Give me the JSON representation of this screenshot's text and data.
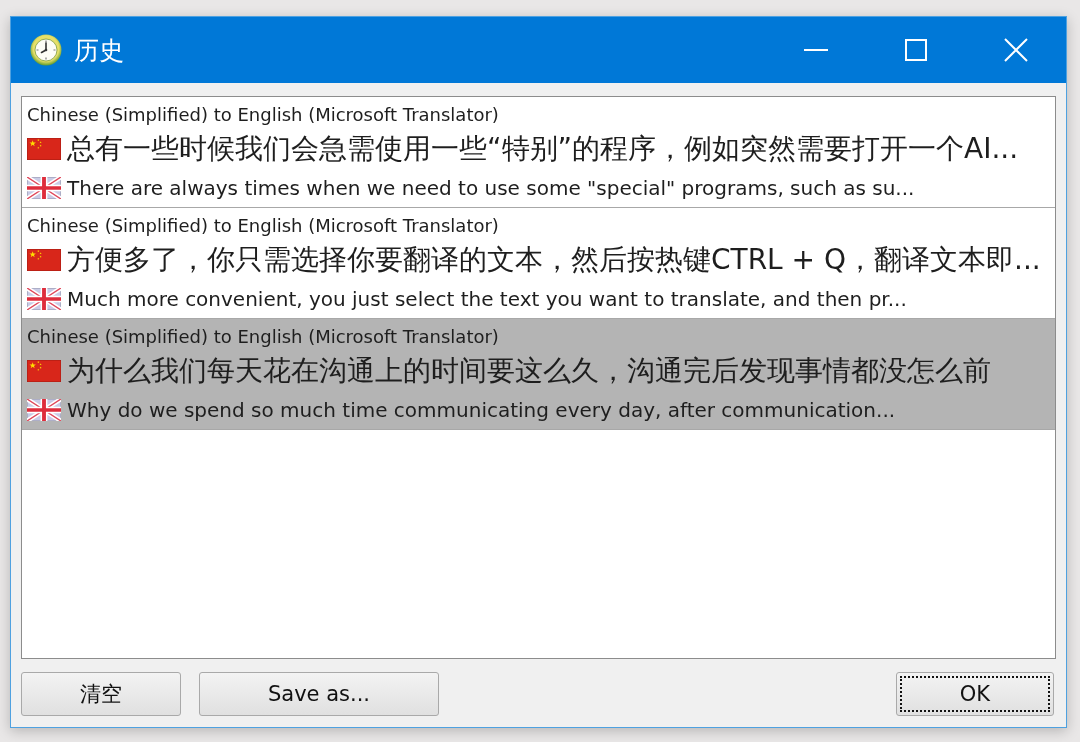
{
  "window": {
    "title": "历史"
  },
  "history": [
    {
      "header": "Chinese (Simplified) to English (Microsoft Translator)",
      "source_text": "总有一些时候我们会急需使用一些“特别”的程序，例如突然需要打开一个AI...",
      "translation": "There are always times when we need to use some \"special\" programs, such as su...",
      "selected": false
    },
    {
      "header": "Chinese (Simplified) to English (Microsoft Translator)",
      "source_text": "方便多了，你只需选择你要翻译的文本，然后按热键CTRL + Q，翻译文本即...",
      "translation": "Much more convenient, you just select the text you want to translate, and then pr...",
      "selected": false
    },
    {
      "header": "Chinese (Simplified) to English (Microsoft Translator)",
      "source_text": "为什么我们每天花在沟通上的时间要这么久，沟通完后发现事情都没怎么前",
      "translation": "Why do we spend so much time communicating every day, after communication...",
      "selected": true
    }
  ],
  "buttons": [
    {
      "label": "清空",
      "focused": false
    },
    {
      "label": "Save as...",
      "focused": false
    },
    {
      "label": "OK",
      "focused": true
    }
  ]
}
